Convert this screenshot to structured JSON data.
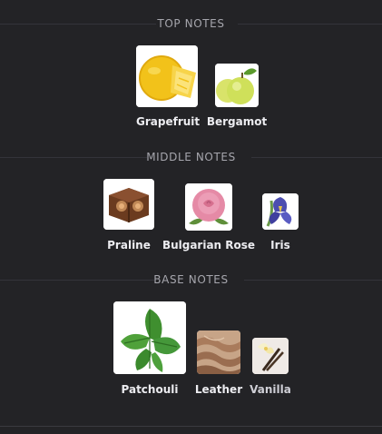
{
  "sections": [
    {
      "title": "TOP NOTES",
      "notes": [
        {
          "name": "Grapefruit",
          "icon": "grapefruit-icon"
        },
        {
          "name": "Bergamot",
          "icon": "bergamot-icon"
        }
      ]
    },
    {
      "title": "MIDDLE NOTES",
      "notes": [
        {
          "name": "Praline",
          "icon": "praline-icon"
        },
        {
          "name": "Bulgarian Rose",
          "icon": "rose-icon"
        },
        {
          "name": "Iris",
          "icon": "iris-icon"
        }
      ]
    },
    {
      "title": "BASE NOTES",
      "notes": [
        {
          "name": "Patchouli",
          "icon": "patchouli-leaf-icon"
        },
        {
          "name": "Leather",
          "icon": "leather-icon"
        },
        {
          "name": "Vanilla",
          "icon": "vanilla-flower-icon"
        }
      ]
    }
  ]
}
